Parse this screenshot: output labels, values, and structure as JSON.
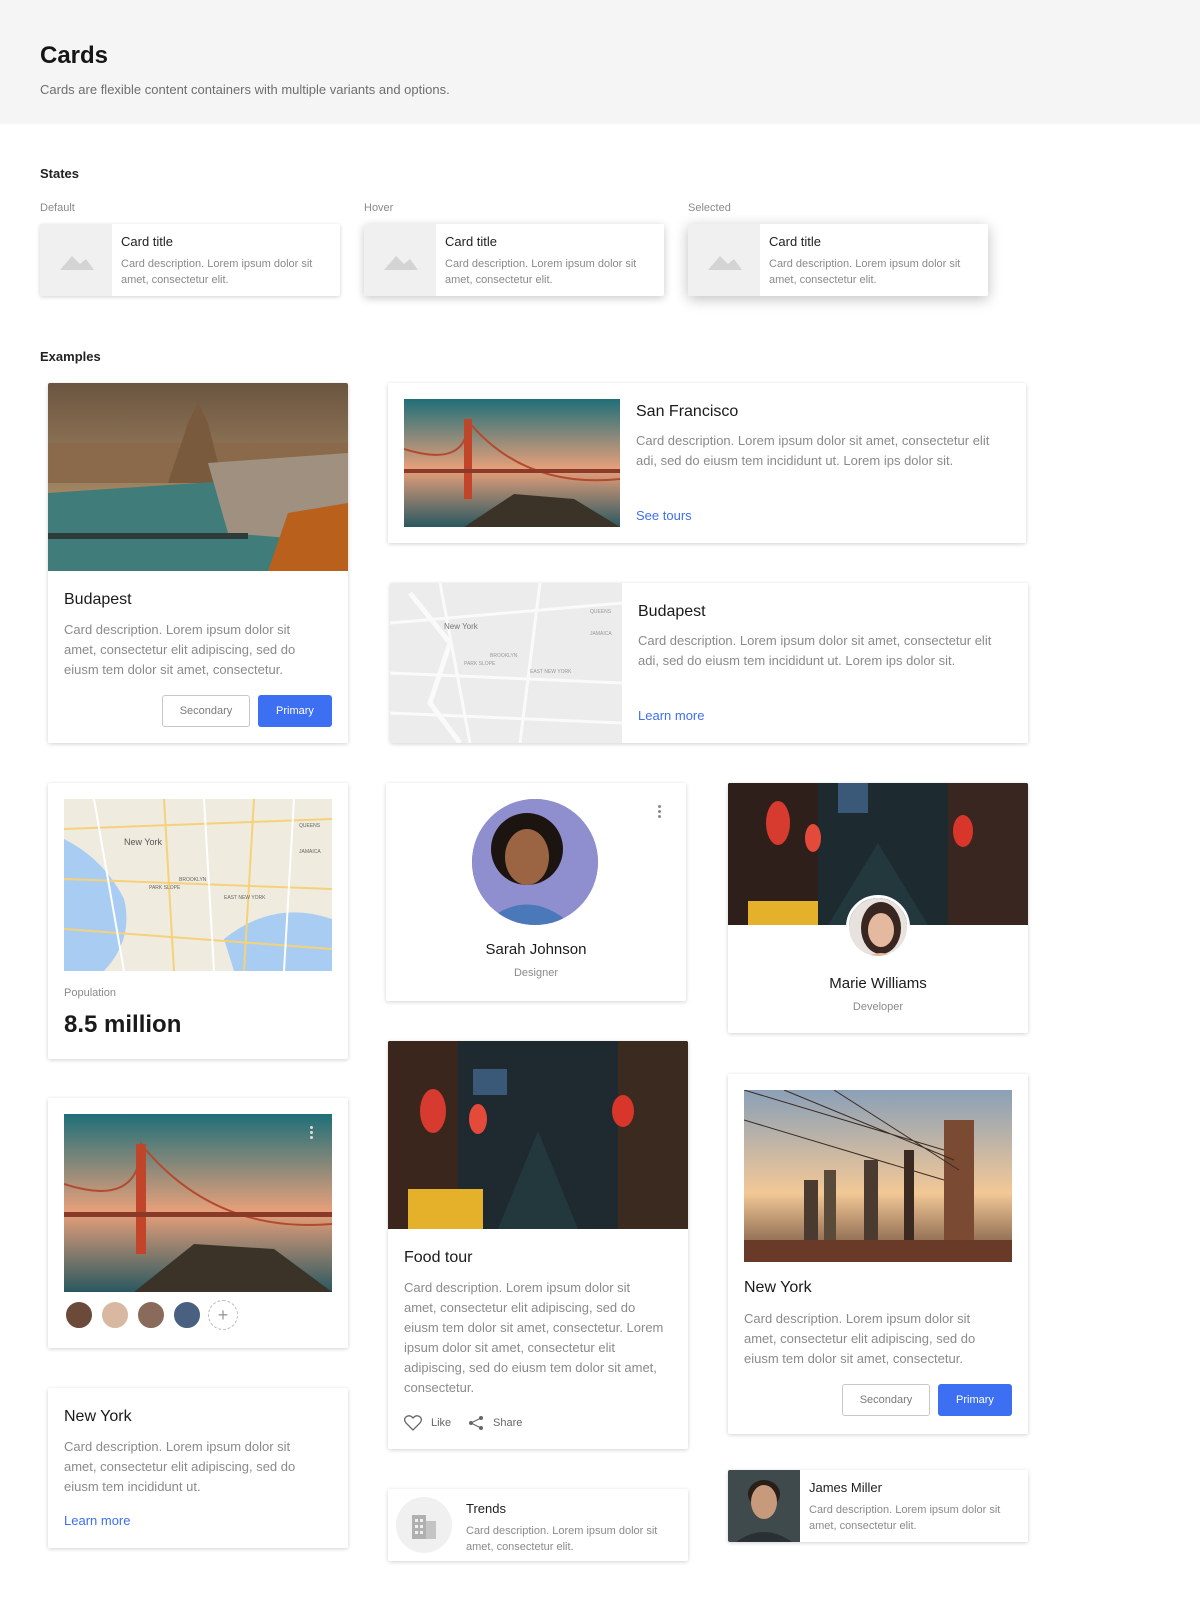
{
  "header": {
    "title": "Cards",
    "subtitle": "Cards are flexible content containers with multiple variants and options."
  },
  "states": {
    "section_title": "States",
    "items": [
      {
        "label": "Default",
        "title": "Card title",
        "desc": "Card description. Lorem ipsum dolor sit amet, consectetur elit."
      },
      {
        "label": "Hover",
        "title": "Card title",
        "desc": "Card description. Lorem ipsum dolor sit amet, consectetur elit."
      },
      {
        "label": "Selected",
        "title": "Card title",
        "desc": "Card description. Lorem ipsum dolor sit amet, consectetur elit."
      }
    ]
  },
  "examples": {
    "section_title": "Examples",
    "budapest_vertical": {
      "title": "Budapest",
      "desc": "Card description. Lorem ipsum dolor sit amet, consectetur elit adipiscing, sed do eiusm tem dolor sit amet, consectetur.",
      "secondary": "Secondary",
      "primary": "Primary"
    },
    "san_francisco": {
      "title": "San Francisco",
      "desc": "Card description. Lorem ipsum dolor sit amet, consectetur elit adi, sed do eiusm tem incididunt ut. Lorem ips dolor sit.",
      "link": "See tours"
    },
    "budapest_map": {
      "title": "Budapest",
      "desc": "Card description. Lorem ipsum dolor sit amet, consectetur elit adi, sed do eiusm tem incididunt ut. Lorem ips dolor sit.",
      "link": "Learn more",
      "map_labels": [
        "New York",
        "BROOKLYN",
        "QUEENS",
        "JAMAICA",
        "PARK SLOPE",
        "EAST NEW YORK"
      ]
    },
    "population": {
      "label": "Population",
      "value": "8.5 million",
      "map_labels": [
        "New York",
        "BROOKLYN",
        "QUEENS",
        "JAMAICA",
        "PARK SLOPE",
        "EAST NEW YORK"
      ]
    },
    "sarah": {
      "name": "Sarah Johnson",
      "role": "Designer"
    },
    "marie": {
      "name": "Marie Williams",
      "role": "Developer"
    },
    "food_tour": {
      "title": "Food tour",
      "desc": "Card description. Lorem ipsum dolor sit amet, consectetur elit adipiscing, sed do eiusm tem dolor sit amet, consectetur. Lorem ipsum dolor sit amet, consectetur elit adipiscing, sed do eiusm tem dolor sit amet, consectetur.",
      "like": "Like",
      "share": "Share"
    },
    "new_york_image": {
      "title": "New York",
      "desc": "Card description. Lorem ipsum dolor sit amet, consectetur elit adipiscing, sed do eiusm tem dolor sit amet, consectetur.",
      "secondary": "Secondary",
      "primary": "Primary"
    },
    "new_york_text": {
      "title": "New York",
      "desc": "Card description. Lorem ipsum dolor sit amet, consectetur elit adipiscing, sed do eiusm tem incididunt ut.",
      "link": "Learn more"
    },
    "trends": {
      "title": "Trends",
      "desc": "Card description. Lorem ipsum dolor sit amet, consectetur elit."
    },
    "james": {
      "name": "James Miller",
      "desc": "Card description. Lorem ipsum dolor sit amet, consectetur elit."
    }
  },
  "colors": {
    "accent": "#3d6ff2",
    "header_bg": "#f5f5f5"
  }
}
